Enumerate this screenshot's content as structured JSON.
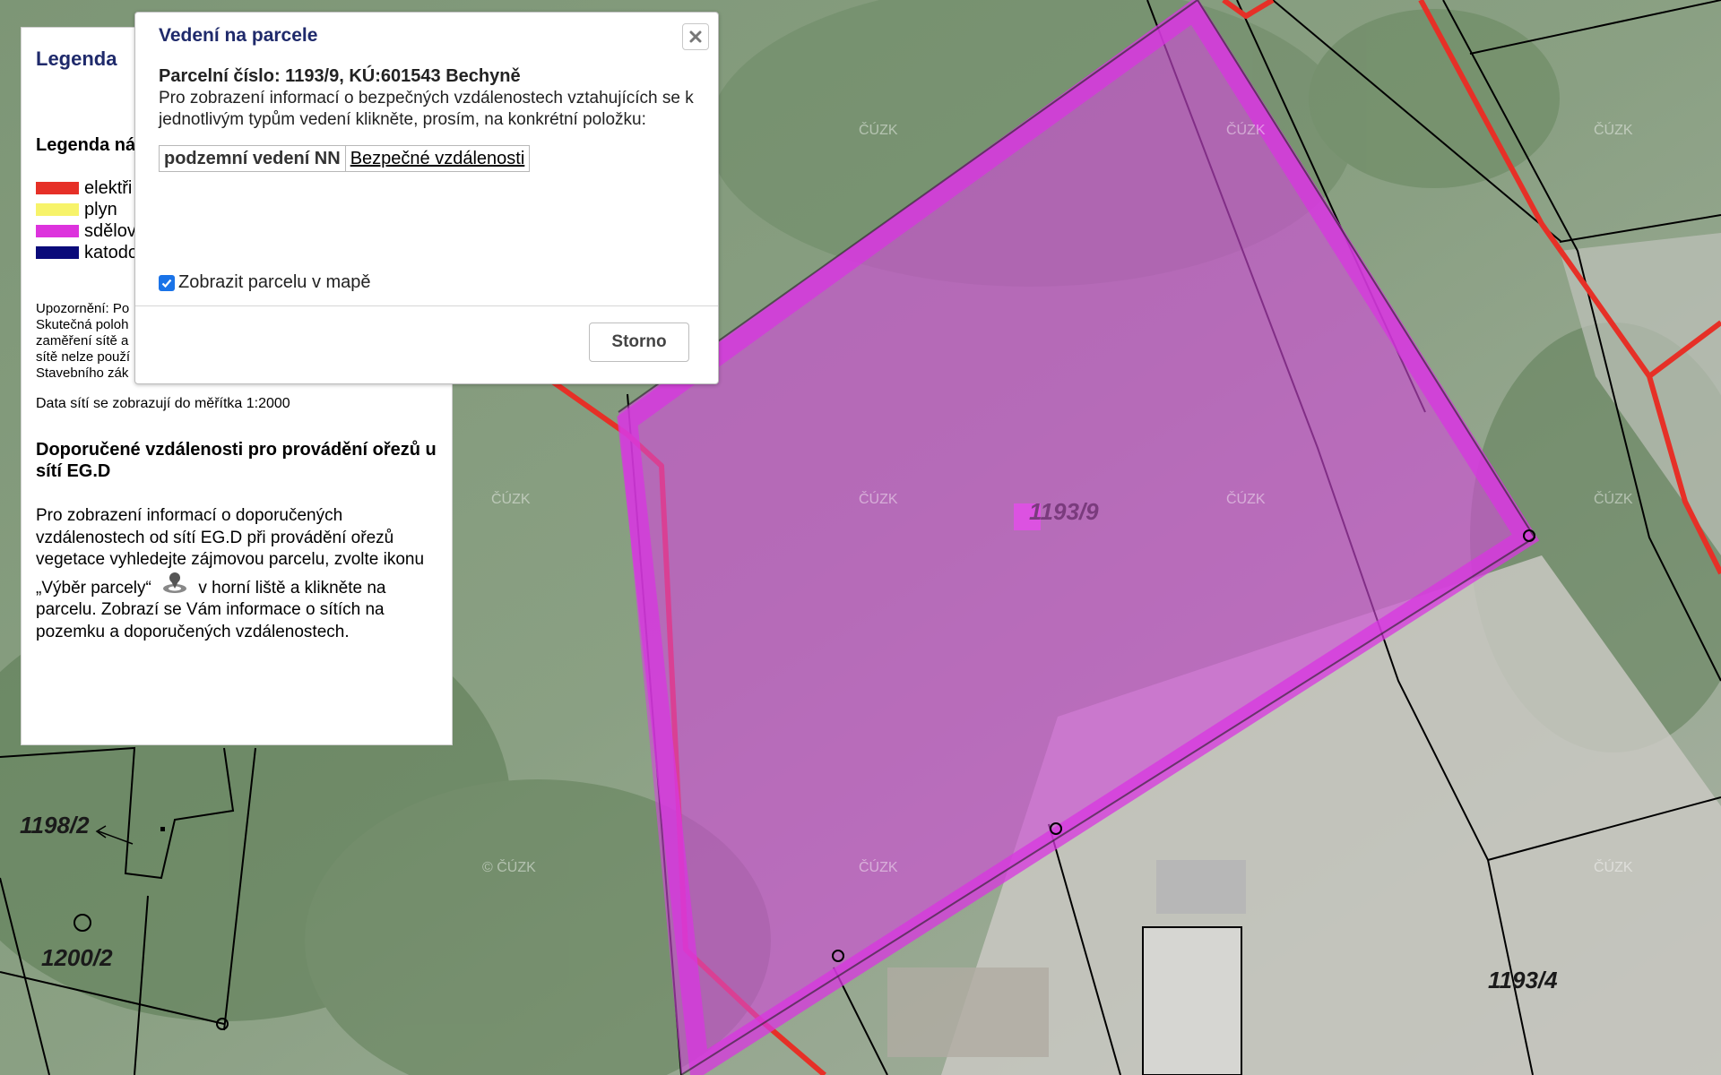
{
  "map": {
    "watermark": "ČÚZK",
    "watermark_copyright": "© ČÚZK",
    "parcel_labels": {
      "main": "1193/9",
      "left_top": "1198/2",
      "left_bottom": "1200/2",
      "right_bottom": "1193/4"
    },
    "colors": {
      "electric": "#e63027",
      "gas": "#f7f36a",
      "telecom": "#dd33dd",
      "cathodic": "#0a0a7a",
      "parcel_fill": "#d14ad9"
    }
  },
  "legend": {
    "title": "Legenda",
    "subtitle": "Legenda ná",
    "items": [
      {
        "label": "elektři",
        "color": "#e63027"
      },
      {
        "label": "plyn",
        "color": "#f7f36a"
      },
      {
        "label": "sdělov",
        "color": "#dd33dd"
      },
      {
        "label": "katodo",
        "color": "#0a0a7a"
      }
    ],
    "warning_lines": [
      "Upozornění: Po",
      "Skutečná poloh",
      "zaměření sítě a",
      "sítě nelze použí",
      "Stavebního zák"
    ],
    "scale_note": "Data sítí se zobrazují do měřítka 1:2000",
    "recommend_title": "Doporučené vzdálenosti pro provádění ořezů u sítí EG.D",
    "recommend_text_before": "Pro zobrazení informací o doporučených vzdálenostech od sítí EG.D při provádění ořezů vegetace vyhledejte zájmovou parcelu, zvolte ikonu „Výběr parcely“",
    "recommend_text_after": "v horní liště a klikněte na parcelu. Zobrazí se Vám informace o sítích na pozemku a doporučených vzdálenostech."
  },
  "dialog": {
    "title": "Vedení na parcele",
    "parcel": "Parcelní číslo: 1193/9, KÚ:601543 Bechyně",
    "info": "Pro zobrazení informací o bezpečných vzdálenostech vztahujících se k jednotlivým typům vedení klikněte, prosím, na konkrétní položku:",
    "rows": [
      {
        "type": "podzemní vedení NN",
        "link": "Bezpečné vzdálenosti"
      }
    ],
    "show_parcel_label": "Zobrazit parcelu v mapě",
    "show_parcel_checked": true,
    "cancel_label": "Storno"
  }
}
